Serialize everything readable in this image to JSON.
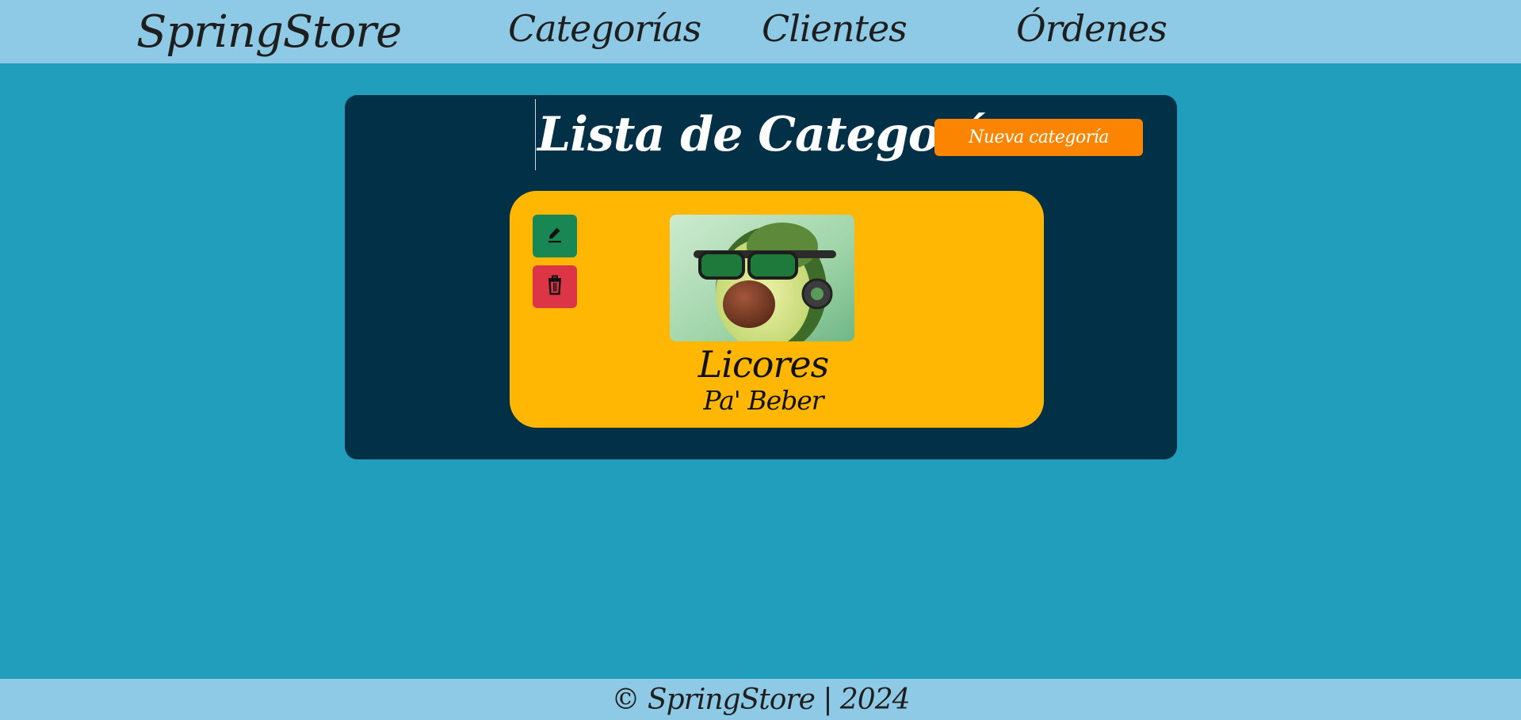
{
  "navbar": {
    "brand": "SpringStore",
    "links": [
      {
        "label": "Categorías"
      },
      {
        "label": "Clientes"
      },
      {
        "label": "Órdenes"
      }
    ]
  },
  "page": {
    "title": "Lista de Categorías",
    "new_button_label": "Nueva categoría"
  },
  "category_card": {
    "name": "Licores",
    "description": "Pa' Beber",
    "edit_icon": "pencil-icon",
    "delete_icon": "trash-icon",
    "image": "avocado-with-sunglasses-image"
  },
  "footer": {
    "text": "© SpringStore | 2024"
  },
  "colors": {
    "background": "#219ebc",
    "navbar": "#8ecae6",
    "panel": "#023047",
    "card": "#ffb703",
    "new_button": "#fb8500",
    "edit_button": "#198754",
    "delete_button": "#dc3545"
  }
}
